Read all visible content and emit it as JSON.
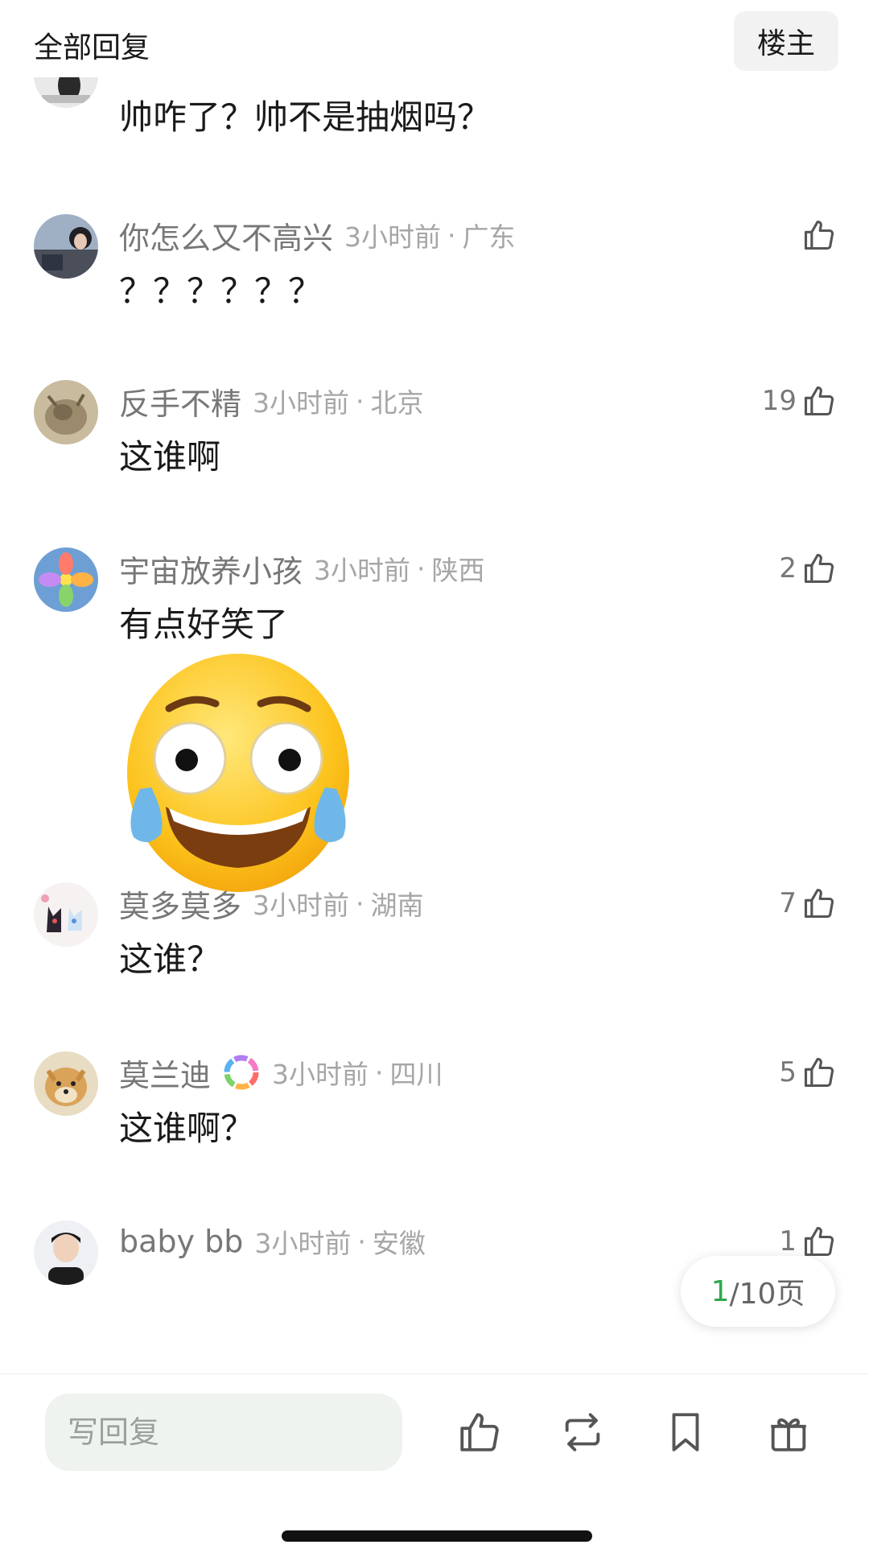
{
  "header": {
    "title": "全部回复",
    "op_label": "楼主"
  },
  "comments": [
    {
      "username": "",
      "time": "",
      "location": "",
      "likes": "",
      "text": "帅咋了？帅不是抽烟吗？"
    },
    {
      "username": "你怎么又不高兴",
      "time": "3小时前",
      "location": "广东",
      "likes": "",
      "text": "？？？？？？"
    },
    {
      "username": "反手不精",
      "time": "3小时前",
      "location": "北京",
      "likes": "19",
      "text": "这谁啊"
    },
    {
      "username": "宇宙放养小孩",
      "time": "3小时前",
      "location": "陕西",
      "likes": "2",
      "text": "有点好笑了",
      "sticker": "laughing-crying-face"
    },
    {
      "username": "莫多莫多",
      "time": "3小时前",
      "location": "湖南",
      "likes": "7",
      "text": "这谁？"
    },
    {
      "username": "莫兰迪",
      "time": "3小时前",
      "location": "四川",
      "likes": "5",
      "text": "这谁啊？",
      "badge": "rainbow-ring-badge"
    },
    {
      "username": "baby bb",
      "time": "3小时前",
      "location": "安徽",
      "likes": "1",
      "text": ""
    }
  ],
  "pagination": {
    "current": "1",
    "total_label": "/10页"
  },
  "bottom_bar": {
    "reply_placeholder": "写回复",
    "icons": [
      "thumbs-up-icon",
      "repost-icon",
      "bookmark-icon",
      "gift-icon"
    ]
  },
  "colors": {
    "accent_green": "#2fa84f",
    "meta_gray": "#a6a6a6",
    "username_gray": "#777777"
  }
}
